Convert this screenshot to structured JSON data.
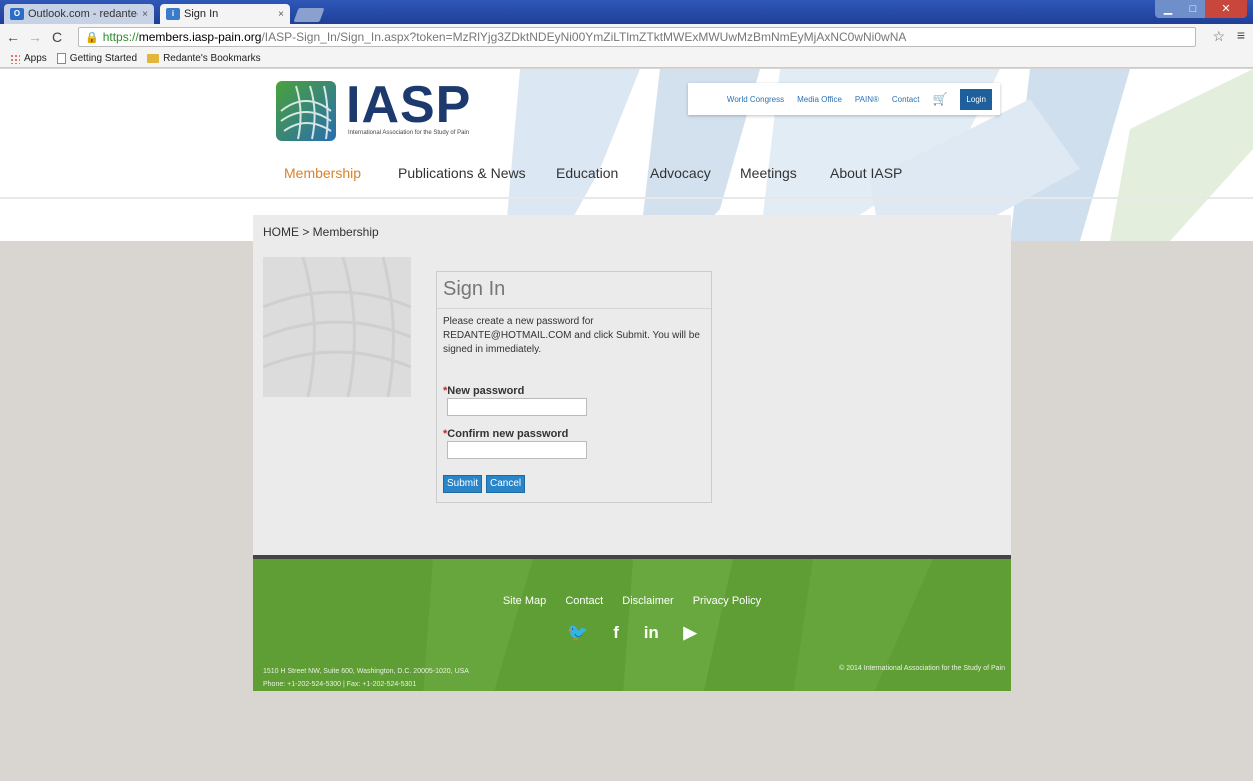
{
  "browser": {
    "tabs": [
      {
        "title": "Outlook.com - redante@h",
        "icon": "outlook-icon",
        "active": false
      },
      {
        "title": "Sign In",
        "icon": "iasp-icon",
        "active": true
      }
    ],
    "url_https": "https://",
    "url_host": "members.iasp-pain.org",
    "url_path": "/IASP-Sign_In/Sign_In.aspx?token=MzRlYjg3ZDktNDEyNi00YmZiLTlmZTktMWExMWUwMzBmNmEyMjAxNC0wNi0wNA",
    "bookmarks": [
      "Apps",
      "Getting Started",
      "Redante's Bookmarks"
    ]
  },
  "site": {
    "logo_text": "IASP",
    "logo_sub": "International Association for the Study of Pain",
    "utility_links": [
      "World Congress",
      "Media Office",
      "PAIN®",
      "Contact"
    ],
    "login_label": "Login",
    "nav": [
      "Membership",
      "Publications & News",
      "Education",
      "Advocacy",
      "Meetings",
      "About IASP"
    ],
    "active_nav": "Membership"
  },
  "content": {
    "breadcrumb": "HOME > Membership",
    "signin": {
      "title": "Sign In",
      "message": "Please create a new password for REDANTE@HOTMAIL.COM and click Submit. You will be signed in immediately.",
      "new_password_label": "New password",
      "confirm_password_label": "Confirm new password",
      "required_mark": "*",
      "submit_label": "Submit",
      "cancel_label": "Cancel"
    }
  },
  "footer": {
    "links": [
      "Site Map",
      "Contact",
      "Disclaimer",
      "Privacy Policy"
    ],
    "social": [
      "twitter-icon",
      "facebook-icon",
      "linkedin-icon",
      "youtube-icon"
    ],
    "social_glyphs": {
      "twitter": "🐦",
      "facebook": "f",
      "linkedin": "in",
      "youtube": "▶"
    },
    "address_line1": "1510 H Street NW, Suite 600, Washington, D.C. 20005-1020, USA",
    "address_line2": "Phone: +1-202-524-5300 | Fax: +1-202-524-5301",
    "copyright": "© 2014 International Association for the Study of Pain"
  },
  "colors": {
    "nav_active": "#d9822b",
    "link_blue": "#2a73b4",
    "footer_green": "#5e9e35",
    "button_blue": "#2a85c8"
  }
}
